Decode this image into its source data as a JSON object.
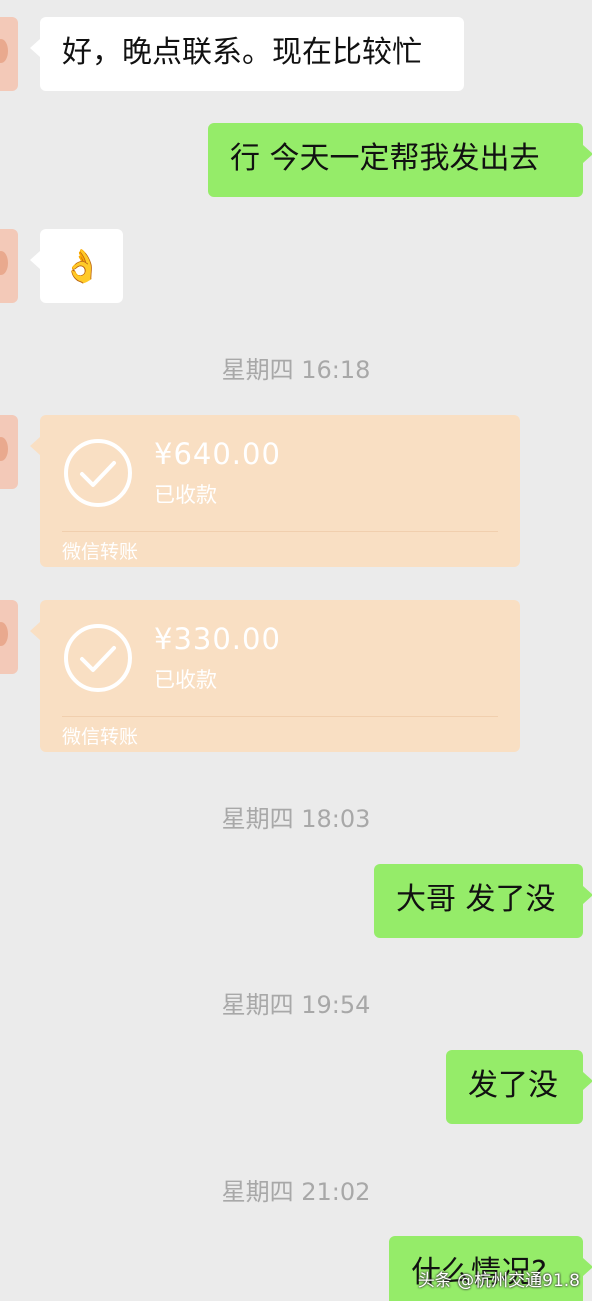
{
  "messages": {
    "m1": "好，晚点联系。现在比较忙",
    "m2": "行  今天一定帮我发出去",
    "m3_emoji": "👌",
    "m5": "大哥 发了没",
    "m6": "发了没",
    "m7": "什么情况?"
  },
  "timestamps": {
    "t1": "星期四 16:18",
    "t2": "星期四 18:03",
    "t3": "星期四 19:54",
    "t4": "星期四 21:02"
  },
  "transfers": [
    {
      "amount": "¥640.00",
      "status": "已收款",
      "footer": "微信转账"
    },
    {
      "amount": "¥330.00",
      "status": "已收款",
      "footer": "微信转账"
    }
  ],
  "watermark": "头条 @杭州交通91.8",
  "colors": {
    "background": "#ebebeb",
    "sent_bubble": "#95ec69",
    "received_bubble": "#ffffff",
    "transfer_card": "#f9dfc3",
    "timestamp_text": "#a8a8a8"
  },
  "icons": {
    "transfer_status": "check-circle-icon",
    "emoji": "ok-hand-emoji"
  }
}
